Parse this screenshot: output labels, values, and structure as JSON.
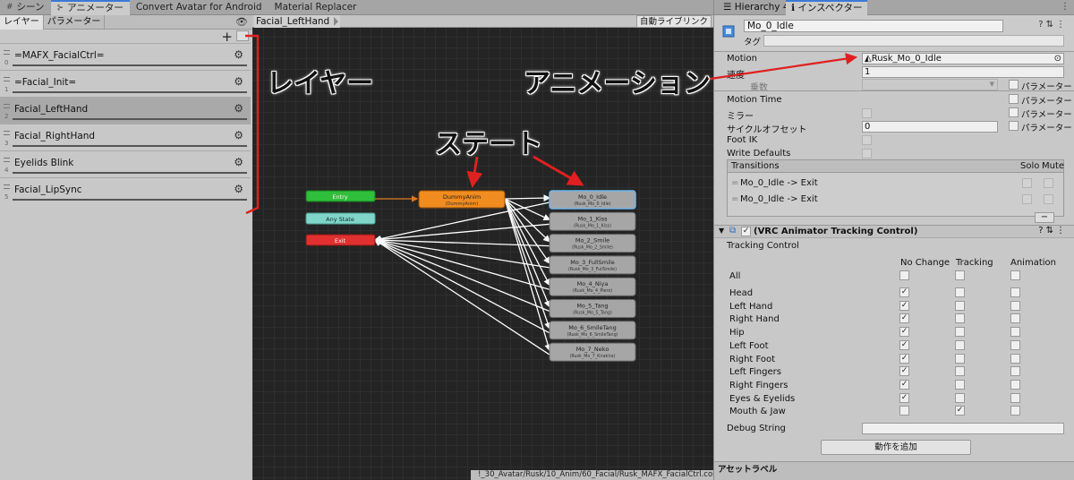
{
  "top_tabs": [
    {
      "label": "シーン",
      "icon": "#"
    },
    {
      "label": "アニメーター",
      "icon": "⊱"
    },
    {
      "label": "Convert Avatar for Android"
    },
    {
      "label": "Material Replacer"
    }
  ],
  "layers_panel": {
    "tabs": [
      "レイヤー",
      "パラメーター"
    ],
    "layers": [
      {
        "name": "=MAFX_FacialCtrl=",
        "index": "0"
      },
      {
        "name": "=Facial_Init=",
        "index": "1"
      },
      {
        "name": "Facial_LeftHand",
        "index": "2"
      },
      {
        "name": "Facial_RightHand",
        "index": "3"
      },
      {
        "name": "Eyelids Blink",
        "index": "4"
      },
      {
        "name": "Facial_LipSync",
        "index": "5"
      }
    ]
  },
  "graph": {
    "breadcrumb": "Facial_LeftHand",
    "auto_live_label": "自動ライブリンク",
    "footer_path": "!_30_Avatar/Rusk/10_Anim/60_Facial/Rusk_MAFX_FacialCtrl.controller",
    "entry_label": "Entry",
    "anystate_label": "Any State",
    "exit_label": "Exit",
    "dummy": {
      "name": "DummyAnim",
      "motion": "(DummyAnim)"
    },
    "states": [
      {
        "name": "Mo_0_Idle",
        "motion": "(Rusk_Mo_0_Idle)"
      },
      {
        "name": "Mo_1_Kiss",
        "motion": "(Rusk_Mo_1_Kiss)"
      },
      {
        "name": "Mo_2_Smile",
        "motion": "(Rusk_Mo_2_Smile)"
      },
      {
        "name": "Mo_3_FullSmile",
        "motion": "(Rusk_Mo_3_FullSmile)"
      },
      {
        "name": "Mo_4_Niya",
        "motion": "(Rusk_Mo_4_Piero)"
      },
      {
        "name": "Mo_5_Tang",
        "motion": "(Rusk_Mo_5_Tang)"
      },
      {
        "name": "Mo_6_SmileTang",
        "motion": "(Rusk_Mo_6_SmileTang)"
      },
      {
        "name": "Mo_7_Neko",
        "motion": "(Rusk_Mo_7_Kirakira)"
      }
    ]
  },
  "inspector": {
    "tabs": [
      "Hierarchy 4",
      "インスペクター"
    ],
    "object_name": "Mo_0_Idle",
    "tag_label": "タグ",
    "motion_label": "Motion",
    "motion_value": "Rusk_Mo_0_Idle",
    "speed_label": "速度",
    "speed_value": "1",
    "multiplier_label": "乗数",
    "param_label": "パラメーター",
    "motion_time_label": "Motion Time",
    "mirror_label": "ミラー",
    "cycle_offset_label": "サイクルオフセット",
    "cycle_offset_value": "0",
    "foot_ik_label": "Foot IK",
    "write_defaults_label": "Write Defaults",
    "transitions_label": "Transitions",
    "solo_label": "Solo",
    "mute_label": "Mute",
    "transitions": [
      "Mo_0_Idle -> Exit",
      "Mo_0_Idle -> Exit"
    ],
    "component_title": "(VRC Animator Tracking Control)",
    "tracking_control_label": "Tracking Control",
    "columns": [
      "No Change",
      "Tracking",
      "Animation"
    ],
    "all_label": "All",
    "tracking_rows": [
      {
        "label": "Head",
        "no_change": true,
        "tracking": false
      },
      {
        "label": "Left Hand",
        "no_change": true,
        "tracking": false
      },
      {
        "label": "Right Hand",
        "no_change": true,
        "tracking": false
      },
      {
        "label": "Hip",
        "no_change": true,
        "tracking": false
      },
      {
        "label": "Left Foot",
        "no_change": true,
        "tracking": false
      },
      {
        "label": "Right Foot",
        "no_change": true,
        "tracking": false
      },
      {
        "label": "Left Fingers",
        "no_change": true,
        "tracking": false
      },
      {
        "label": "Right Fingers",
        "no_change": true,
        "tracking": false
      },
      {
        "label": "Eyes & Eyelids",
        "no_change": true,
        "tracking": false
      },
      {
        "label": "Mouth & Jaw",
        "no_change": false,
        "tracking": true
      }
    ],
    "debug_string_label": "Debug String",
    "add_behaviour_label": "動作を追加",
    "asset_label": "アセットラベル"
  },
  "annotations": {
    "layer": "レイヤー",
    "state": "ステート",
    "animation": "アニメーション"
  },
  "colors": {
    "accent_tab": "#3a79d8",
    "entry": "#2fbf3b",
    "anystate": "#7fd6c8",
    "exit": "#e03030",
    "default_state": "#f08c20",
    "state": "#a6a6a6",
    "annotation_red": "#e02020"
  }
}
